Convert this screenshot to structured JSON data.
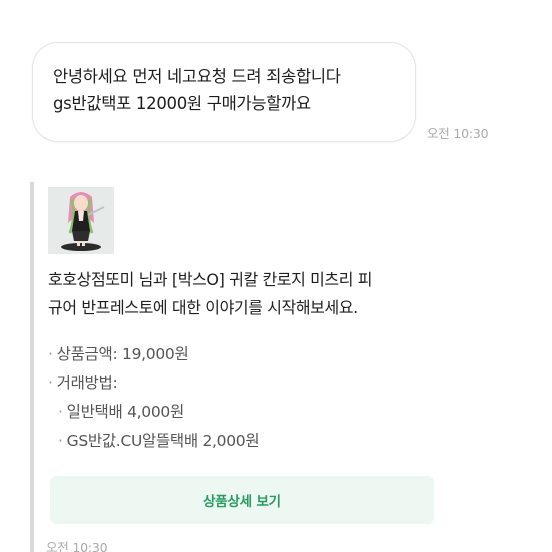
{
  "message": {
    "lines": [
      "안녕하세요 먼저 네고요청 드려 죄송합니다",
      "gs반값택포 12000원 구매가능할까요"
    ],
    "time": "오전 10:30"
  },
  "product_card": {
    "thumbnail": "figure-thumbnail",
    "intro_lines": [
      "호호상점또미 님과 [박스O] 귀칼 칸로지 미츠리 피",
      "규어 반프레스토에 대한 이야기를 시작해보세요."
    ],
    "bullet": "·",
    "price_label": "상품금액: 19,000원",
    "method_label": "거래방법:",
    "methods": [
      "일반택배 4,000원",
      "GS반값.CU알뜰택배 2,000원"
    ],
    "detail_button": "상품상세 보기",
    "time": "오전 10:30"
  },
  "colors": {
    "accent": "#2a9a63",
    "button_bg": "#edf8f2",
    "timestamp": "#a9a9a9"
  }
}
